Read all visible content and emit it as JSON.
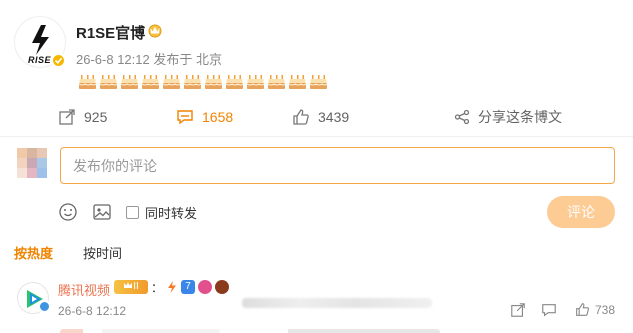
{
  "post": {
    "author": "R1SE官博",
    "avatar_text": "RISE",
    "meta": "26-6-8 12:12  发布于 北京",
    "cake_emoji": "cake-icon",
    "cake_count": 12
  },
  "actions": {
    "repost_count": "925",
    "comment_count": "1658",
    "like_count": "3439",
    "share_label": "分享这条博文"
  },
  "composer": {
    "placeholder": "发布你的评论",
    "repost_label": "同时转发",
    "submit_label": "评论"
  },
  "sort": {
    "hot_label": "按热度",
    "time_label": "按时间"
  },
  "comment": {
    "author": "腾讯视频",
    "badge_level": "II",
    "colon": "：",
    "time": "26-6-8 12:12",
    "like_count": "738"
  },
  "colors": {
    "accent": "#f08300",
    "submit_disabled": "#fdcb94",
    "input_border": "#f3a64a",
    "name_link": "#eb7350"
  }
}
